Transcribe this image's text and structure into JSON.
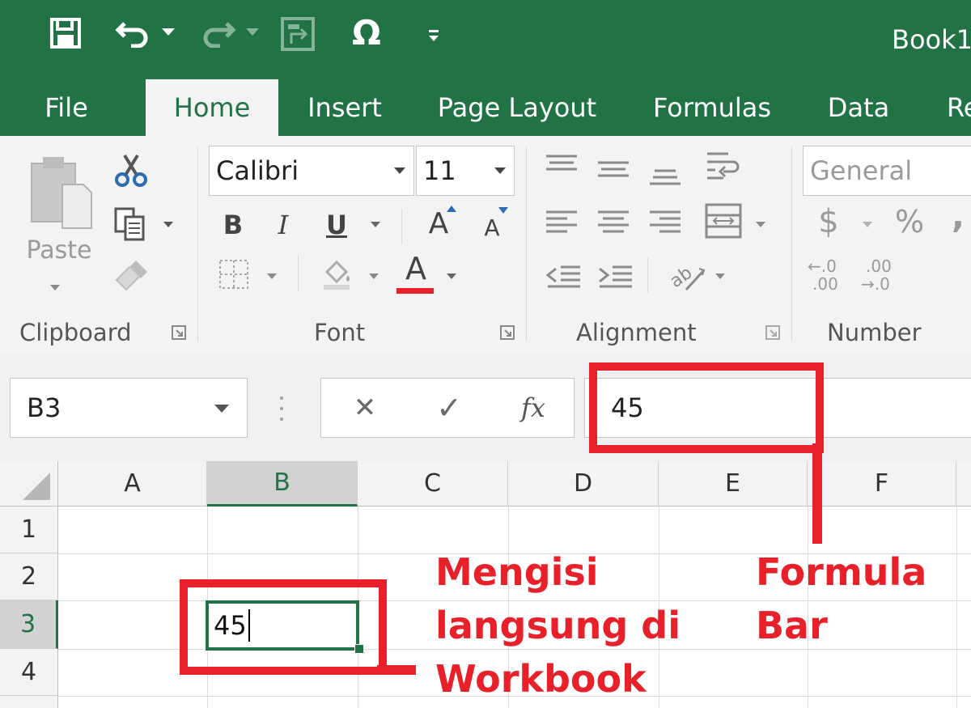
{
  "window": {
    "title": "Book1",
    "brand_color": "#217346"
  },
  "quick_access": {
    "save_icon": "save-icon",
    "undo_icon": "undo-icon",
    "redo_icon": "redo-icon",
    "form_icon": "form-icon",
    "symbol_label": "Ω",
    "customize_icon": "customize-qat-icon"
  },
  "tabs": [
    {
      "label": "File"
    },
    {
      "label": "Home",
      "active": true
    },
    {
      "label": "Insert"
    },
    {
      "label": "Page Layout"
    },
    {
      "label": "Formulas"
    },
    {
      "label": "Data"
    },
    {
      "label": "Re"
    }
  ],
  "ribbon": {
    "clipboard": {
      "label": "Clipboard",
      "paste_label": "Paste"
    },
    "font": {
      "label": "Font",
      "font_name": "Calibri",
      "font_size": "11",
      "bold": "B",
      "italic": "I",
      "underline": "U",
      "grow": "A",
      "shrink": "A",
      "font_color_label": "A",
      "font_color": "#e8202a"
    },
    "alignment": {
      "label": "Alignment"
    },
    "number": {
      "label": "Number",
      "format": "General",
      "currency": "$",
      "percent": "%",
      "comma": ",",
      "inc_decimal_top": "←.0",
      "inc_decimal_bottom": ".00",
      "dec_decimal_top": ".00",
      "dec_decimal_bottom": "→.0"
    }
  },
  "formula_bar": {
    "name_box": "B3",
    "cancel_symbol": "✕",
    "enter_symbol": "✓",
    "fx_label": "fx",
    "value": "45"
  },
  "grid": {
    "columns": [
      "A",
      "B",
      "C",
      "D",
      "E",
      "F"
    ],
    "rows": [
      "1",
      "2",
      "3",
      "4"
    ],
    "active_cell": "B3",
    "active_value": "45"
  },
  "annotations": {
    "cell_note_line1": "Mengisi",
    "cell_note_line2": "langsung di",
    "cell_note_line3": "Workbook",
    "formula_note_line1": "Formula",
    "formula_note_line2": "Bar",
    "color": "#e8202a"
  }
}
